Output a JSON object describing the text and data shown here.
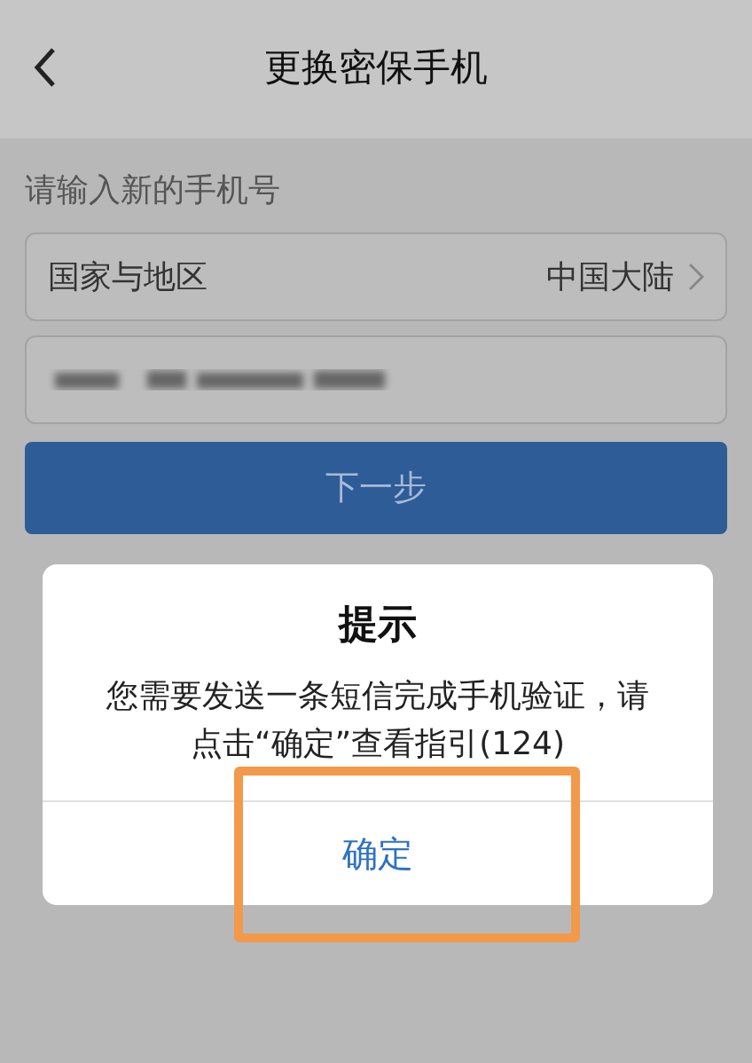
{
  "header": {
    "title": "更换密保手机"
  },
  "form": {
    "prompt": "请输入新的手机号",
    "region": {
      "label": "国家与地区",
      "value": "中国大陆"
    },
    "next_button": "下一步"
  },
  "dialog": {
    "title": "提示",
    "message": "您需要发送一条短信完成手机验证，请点击“确定”查看指引(124)",
    "confirm_button": "确定",
    "highlighted": true
  }
}
